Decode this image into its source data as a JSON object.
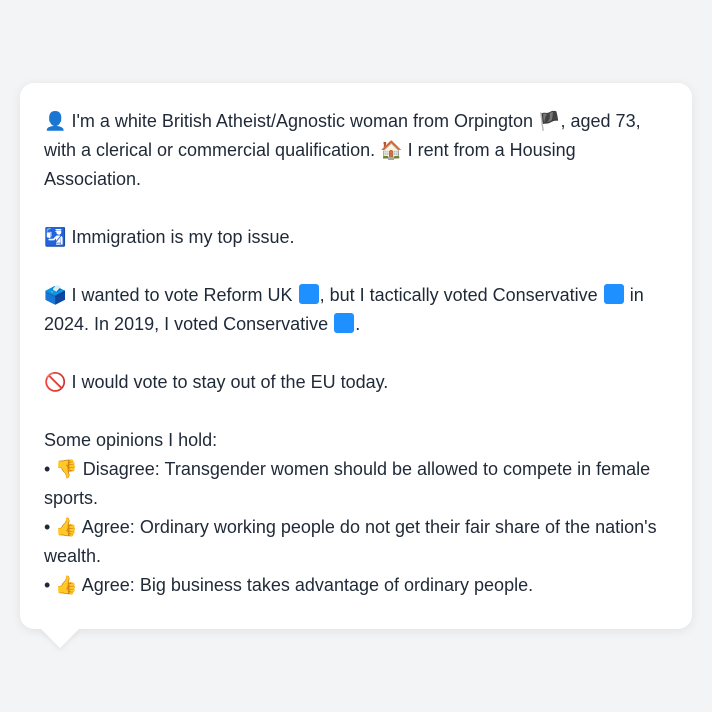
{
  "persona": {
    "intro": {
      "icon": "👤",
      "text_a": "I'm a white British Atheist/Agnostic woman from Orpington",
      "flag": "🏴",
      "text_b": ", aged 73, with a clerical or commercial qualification.",
      "house_icon": "🏠",
      "text_c": "I rent from a Housing Association."
    },
    "issue": {
      "icon": "🛂",
      "text": "Immigration is my top issue."
    },
    "vote": {
      "icon": "🗳️",
      "text_a": "I wanted to vote Reform UK",
      "text_b": ", but I tactically voted Conservative",
      "text_c": "in 2024. In 2019, I voted Conservative",
      "text_d": ".",
      "reform_color": "#1e90ff",
      "conservative_color": "#1e90ff"
    },
    "eu": {
      "icon": "🚫",
      "text": "I would vote to stay out of the EU today."
    },
    "opinions": {
      "heading": "Some opinions I hold:",
      "items": [
        {
          "bullet": "•",
          "icon": "👎",
          "stance": "Disagree:",
          "text": "Transgender women should be allowed to compete in female sports."
        },
        {
          "bullet": "•",
          "icon": "👍",
          "stance": "Agree:",
          "text": "Ordinary working people do not get their fair share of the nation's wealth."
        },
        {
          "bullet": "•",
          "icon": "👍",
          "stance": "Agree:",
          "text": "Big business takes advantage of ordinary people."
        }
      ]
    }
  }
}
